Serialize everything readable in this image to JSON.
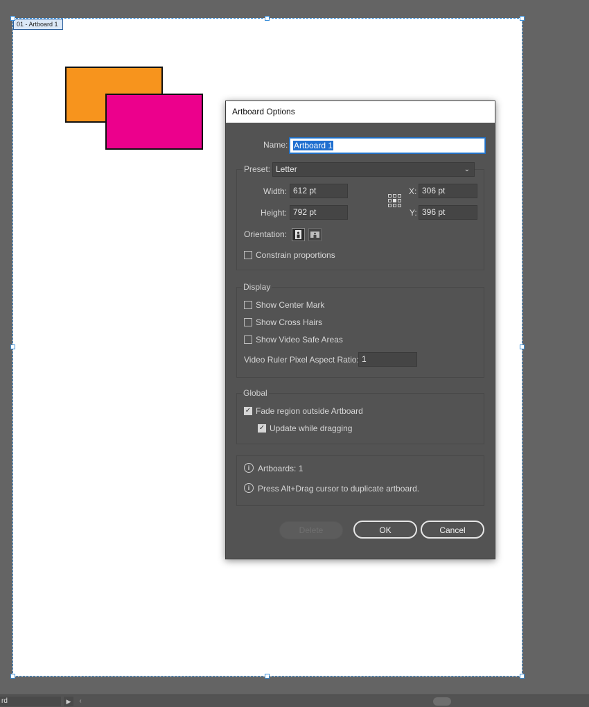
{
  "artboard": {
    "label": "01 - Artboard 1",
    "shapes": [
      {
        "name": "orange-rectangle",
        "fill": "#f7941d"
      },
      {
        "name": "magenta-rectangle",
        "fill": "#ec008c"
      }
    ]
  },
  "statusbar": {
    "artboard_name": "rd",
    "menu_arrow": "▶",
    "scroll_left": "‹"
  },
  "dialog": {
    "title": "Artboard Options",
    "name_label": "Name:",
    "name_value": "Artboard 1",
    "preset_label": "Preset:",
    "preset_value": "Letter",
    "width_label": "Width:",
    "width_value": "612 pt",
    "height_label": "Height:",
    "height_value": "792 pt",
    "x_label": "X:",
    "x_value": "306 pt",
    "y_label": "Y:",
    "y_value": "396 pt",
    "orientation_label": "Orientation:",
    "constrain_label": "Constrain proportions",
    "constrain_checked": false,
    "display": {
      "title": "Display",
      "center_mark": "Show Center Mark",
      "cross_hairs": "Show Cross Hairs",
      "video_safe": "Show Video Safe Areas",
      "pixel_ratio_label": "Video Ruler Pixel Aspect Ratio:",
      "pixel_ratio_value": "1"
    },
    "global": {
      "title": "Global",
      "fade_region": "Fade region outside Artboard",
      "fade_checked": true,
      "update_dragging": "Update while dragging",
      "update_checked": true
    },
    "info": {
      "artboards": "Artboards: 1",
      "hint": "Press Alt+Drag cursor to duplicate artboard."
    },
    "buttons": {
      "delete": "Delete",
      "ok": "OK",
      "cancel": "Cancel"
    }
  },
  "colors": {
    "pasteboard": "#646464",
    "dialog_bg": "#535353",
    "selection_blue": "#1f6fd0",
    "orange": "#f7941d",
    "magenta": "#ec008c"
  }
}
